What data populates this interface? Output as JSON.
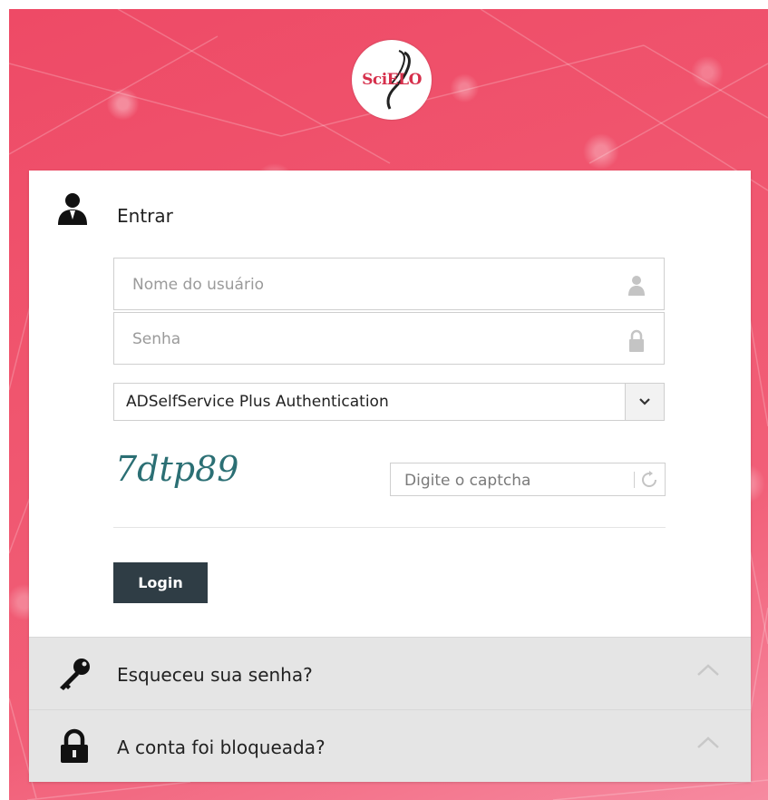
{
  "brand": {
    "logo_text": "SciELO",
    "accent_color": "#ee4a66",
    "button_color": "#2f3d45"
  },
  "login": {
    "heading": "Entrar",
    "heading_icon": "user-icon",
    "username": {
      "placeholder": "Nome do usuário",
      "value": "",
      "icon": "user-icon"
    },
    "password": {
      "placeholder": "Senha",
      "value": "",
      "icon": "lock-icon"
    },
    "auth_select": {
      "selected": "ADSelfService Plus Authentication",
      "icon": "chevron-down-icon"
    },
    "captcha": {
      "image_text": "7dtp89",
      "input_placeholder": "Digite o captcha",
      "refresh_icon": "refresh-icon"
    },
    "submit_label": "Login"
  },
  "accordions": [
    {
      "label": "Esqueceu sua senha?",
      "icon": "key-icon",
      "expand_icon": "chevron-up-icon"
    },
    {
      "label": "A conta foi bloqueada?",
      "icon": "lock-icon",
      "expand_icon": "chevron-up-icon"
    }
  ]
}
